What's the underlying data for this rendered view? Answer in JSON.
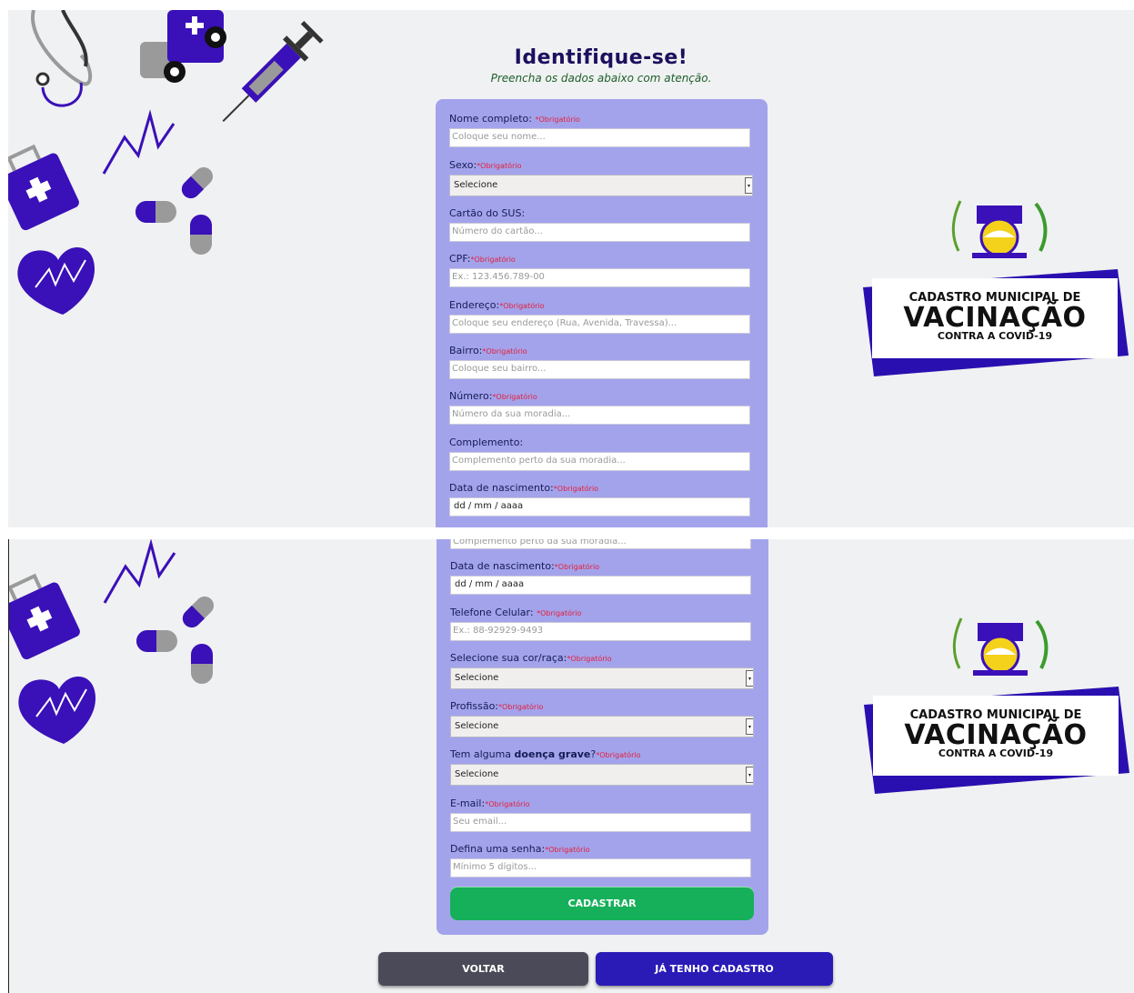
{
  "header": {
    "title": "Identifique-se!",
    "subtitle": "Preencha os dados abaixo com atenção."
  },
  "required_tag": "*Obrigatório",
  "fields": {
    "nome": {
      "label": "Nome completo:",
      "placeholder": "Coloque seu nome..."
    },
    "sexo": {
      "label": "Sexo:",
      "value": "Selecione"
    },
    "sus": {
      "label": "Cartão do SUS:",
      "placeholder": "Número do cartão..."
    },
    "cpf": {
      "label": "CPF:",
      "placeholder": "Ex.: 123.456.789-00"
    },
    "endereco": {
      "label": "Endereço:",
      "placeholder": "Coloque seu endereço (Rua, Avenida, Travessa)..."
    },
    "bairro": {
      "label": "Bairro:",
      "placeholder": "Coloque seu bairro..."
    },
    "numero": {
      "label": "Número:",
      "placeholder": "Número da sua moradia..."
    },
    "complemento": {
      "label": "Complemento:",
      "placeholder": "Complemento perto da sua moradia..."
    },
    "nascimento": {
      "label": "Data de nascimento:",
      "value": "dd / mm / aaaa"
    },
    "telefone": {
      "label": "Telefone Celular:",
      "placeholder": "Ex.: 88-92929-9493"
    },
    "cor": {
      "label": "Selecione sua cor/raça:",
      "value": "Selecione"
    },
    "profissao": {
      "label": "Profissão:",
      "value": "Selecione"
    },
    "doenca": {
      "label_prefix": "Tem alguma",
      "label_bold": "doença grave",
      "label_suffix": "?",
      "value": "Selecione"
    },
    "email": {
      "label": "E-mail:",
      "placeholder": "Seu email..."
    },
    "senha": {
      "label": "Defina uma senha:",
      "placeholder": "Mínimo 5 dígitos..."
    }
  },
  "buttons": {
    "submit": "CADASTRAR",
    "back": "VOLTAR",
    "login": "JÁ TENHO CADASTRO"
  },
  "logo": {
    "line1": "CADASTRO MUNICIPAL DE",
    "line2": "VACINAÇÃO",
    "line3": "CONTRA A COVID-19",
    "accent_color": "#2a0fb0"
  },
  "colors": {
    "panel": "#a3a3ec",
    "accent": "#3a10b8",
    "submit": "#16b05a",
    "back": "#4b4a58",
    "required": "#e3213a"
  }
}
